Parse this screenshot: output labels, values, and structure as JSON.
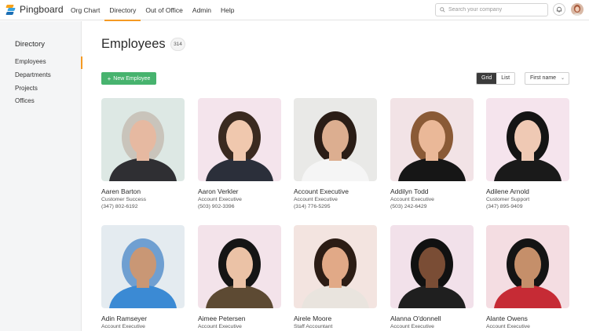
{
  "app": {
    "name": "Pingboard"
  },
  "nav": [
    "Org Chart",
    "Directory",
    "Out of Office",
    "Admin",
    "Help"
  ],
  "search": {
    "placeholder": "Search your company"
  },
  "sidebar": {
    "title": "Directory",
    "items": [
      "Employees",
      "Departments",
      "Projects",
      "Offices"
    ]
  },
  "main": {
    "title": "Employees",
    "count": "314",
    "new_button": "New Employee",
    "view_grid": "Grid",
    "view_list": "List",
    "sort_label": "First name"
  },
  "employees": [
    {
      "name": "Aaren Barton",
      "role": "Customer Success",
      "phone": "(347) 802-6192",
      "bg": "#dde8e4",
      "skin": "#e6b9a1",
      "hair": "#c9c4bb",
      "shirt": "#2f2f33"
    },
    {
      "name": "Aaron Verkler",
      "role": "Account Executive",
      "phone": "(503) 902-3396",
      "bg": "#f4e4ec",
      "skin": "#f0c8ae",
      "hair": "#3a2a20",
      "shirt": "#2b2f3a"
    },
    {
      "name": "Account Executive",
      "role": "Account Executive",
      "phone": "(314) 776-5295",
      "bg": "#e9e9e7",
      "skin": "#dcae90",
      "hair": "#2a1d16",
      "shirt": "#f5f5f5"
    },
    {
      "name": "Addilyn Todd",
      "role": "Account Executive",
      "phone": "(503) 242-6429",
      "bg": "#f2e3e6",
      "skin": "#eab898",
      "hair": "#8a5a36",
      "shirt": "#161616"
    },
    {
      "name": "Adilene Arnold",
      "role": "Customer Support",
      "phone": "(347) 895-9409",
      "bg": "#f5e4ed",
      "skin": "#efc9b4",
      "hair": "#141414",
      "shirt": "#1a1a1a"
    },
    {
      "name": "Adin Ramseyer",
      "role": "Account Executive",
      "phone": "",
      "bg": "#e4ebf0",
      "skin": "#c99775",
      "hair": "#6f9fd1",
      "shirt": "#3b8ad4"
    },
    {
      "name": "Aimee Petersen",
      "role": "Account Executive",
      "phone": "",
      "bg": "#f3e3ea",
      "skin": "#ebc2a6",
      "hair": "#151515",
      "shirt": "#5d4a33"
    },
    {
      "name": "Airele Moore",
      "role": "Staff Accountant",
      "phone": "",
      "bg": "#f3e4e0",
      "skin": "#e1a987",
      "hair": "#2c1d15",
      "shirt": "#e9e4de"
    },
    {
      "name": "Alanna O'donnell",
      "role": "Account Executive",
      "phone": "",
      "bg": "#f2e1ea",
      "skin": "#7a4d35",
      "hair": "#111111",
      "shirt": "#1f1f1f"
    },
    {
      "name": "Alante Owens",
      "role": "Account Executive",
      "phone": "",
      "bg": "#f4dde2",
      "skin": "#c58f6a",
      "hair": "#141414",
      "shirt": "#c62b35"
    }
  ]
}
